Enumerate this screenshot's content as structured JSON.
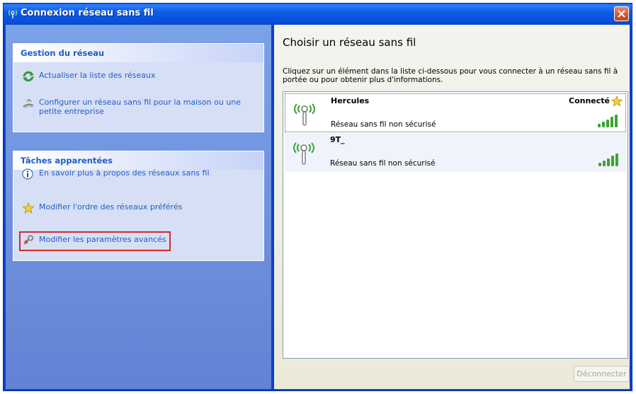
{
  "window": {
    "title": "Connexion réseau sans fil"
  },
  "left": {
    "network_group": {
      "header": "Gestion du réseau",
      "tasks": [
        {
          "label": "Actualiser la liste des réseaux",
          "icon": "refresh-icon"
        },
        {
          "label": "Configurer un réseau sans fil pour la maison ou une petite entreprise",
          "icon": "wizard-icon"
        }
      ]
    },
    "related_group": {
      "header": "Tâches apparentées",
      "tasks": [
        {
          "label": "En savoir plus à propos des réseaux sans fil",
          "icon": "info-icon"
        },
        {
          "label": "Modifier l'ordre des réseaux préférés",
          "icon": "star-icon"
        },
        {
          "label": "Modifier les paramètres avancés",
          "icon": "settings-icon"
        }
      ]
    }
  },
  "right": {
    "heading": "Choisir un réseau sans fil",
    "instructions": "Cliquez sur un élément dans la liste ci-dessous pour vous connecter à un réseau sans fil à portée ou pour obtenir plus d'informations.",
    "networks": [
      {
        "name": "Hercules",
        "security": "Réseau sans fil non sécurisé",
        "status": "Connecté",
        "selected": true,
        "signal_bars": 5
      },
      {
        "name": "9T_",
        "security": "Réseau sans fil non sécurisé",
        "status": "",
        "selected": false,
        "signal_bars": 5
      }
    ],
    "disconnect_label": "Déconnecter"
  },
  "colors": {
    "title_bar": "#0a5ef2",
    "link": "#215dc6",
    "highlight_box": "#d32a2a",
    "signal_green": "#3aa531"
  }
}
